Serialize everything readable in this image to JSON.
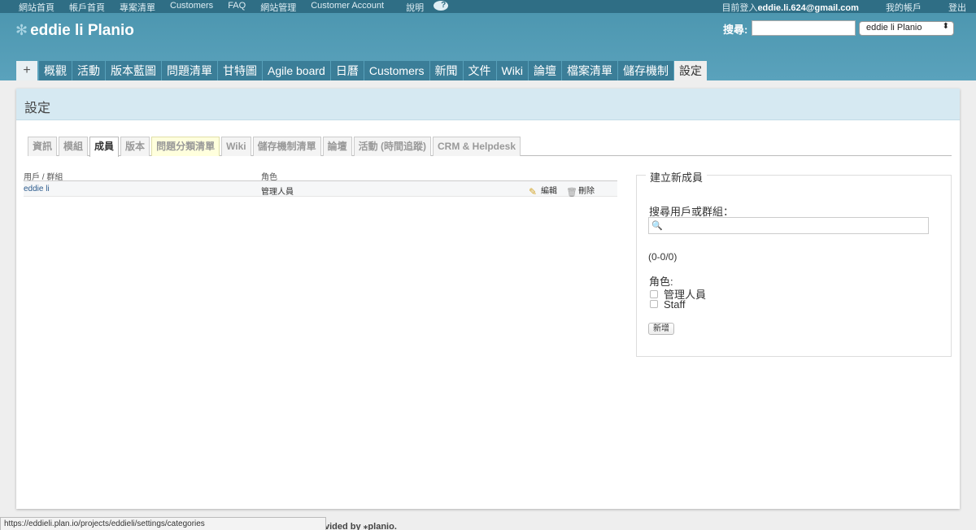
{
  "topbar": {
    "left_links": [
      "網站首頁",
      "帳戶首頁",
      "專案清單",
      "Customers",
      "FAQ",
      "網站管理",
      "Customer Account",
      "說明"
    ],
    "help_icon_glyph": "?",
    "logged_in_label": "目前登入",
    "logged_in_user": "eddie.li.624@gmail.com",
    "my_account": "我的帳戶",
    "logout": "登出"
  },
  "header": {
    "logo_text": "eddie li Planio",
    "search_label": "搜尋:",
    "search_value": "",
    "project_select": "eddie li Planio"
  },
  "main_menu": {
    "plus": "+",
    "tabs": [
      "概觀",
      "活動",
      "版本藍圖",
      "問題清單",
      "甘特圖",
      "Agile board",
      "日曆",
      "Customers",
      "新聞",
      "文件",
      "Wiki",
      "論壇",
      "檔案清單",
      "儲存機制",
      "設定"
    ],
    "active": "設定"
  },
  "page": {
    "title": "設定"
  },
  "settings_tabs": {
    "tabs": [
      "資訊",
      "模組",
      "成員",
      "版本",
      "問題分類清單",
      "Wiki",
      "儲存機制清單",
      "論壇",
      "活動 (時間追蹤)",
      "CRM & Helpdesk"
    ],
    "active": "成員",
    "highlighted": "問題分類清單"
  },
  "members": {
    "header_user": "用戶 / 群組",
    "header_role": "角色",
    "rows": [
      {
        "user": "eddie li",
        "role": "管理人員",
        "edit": "編輯",
        "delete": "刪除"
      }
    ]
  },
  "new_member": {
    "legend": "建立新成員",
    "search_label": "搜尋用戶或群組：",
    "search_value": "",
    "pagination": "(0-0/0)",
    "roles_label": "角色:",
    "roles": [
      "管理人員",
      "Staff"
    ],
    "add_button": "新增"
  },
  "status_bar": {
    "url": "https://eddieli.plan.io/projects/eddieli/settings/categories"
  },
  "footer": {
    "text": "vided by ⁎planio."
  },
  "colors": {
    "header_bg": "#5aa2bc",
    "topbar_bg": "#2f6e85",
    "menu_tab_bg": "#3b7e98",
    "content_head_bg": "#d6e9f2"
  }
}
